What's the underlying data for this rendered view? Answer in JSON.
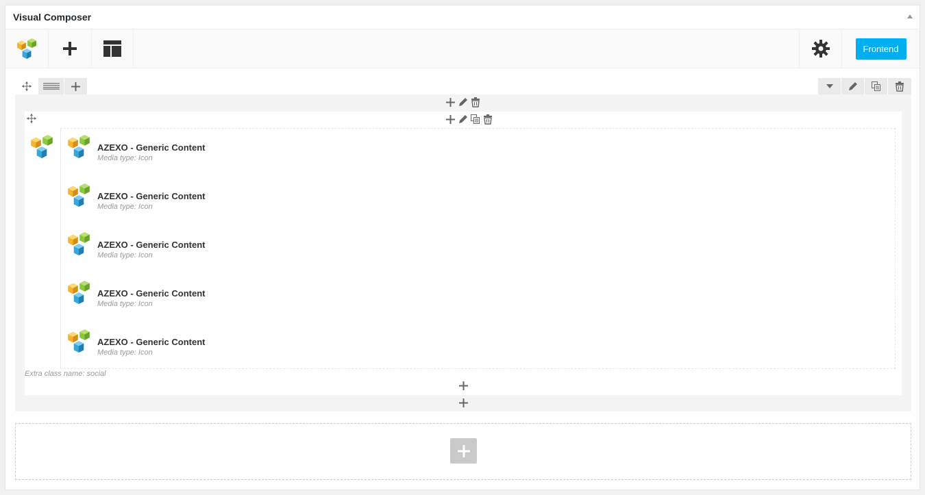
{
  "panel": {
    "title": "Visual Composer"
  },
  "navbar": {
    "logo_icon": "vc-logo-icon",
    "add_element_icon": "plus-icon",
    "templates_icon": "templates-icon",
    "settings_icon": "gear-icon",
    "frontend_label": "Frontend"
  },
  "row": {
    "controls_left": [
      "move-icon",
      "layout-icon",
      "plus-icon"
    ],
    "controls_right": [
      "chevron-down-icon",
      "pencil-icon",
      "copy-icon",
      "trash-icon"
    ],
    "column": {
      "extra_class": "Extra class name: social",
      "elements": [
        {
          "title": "AZEXO - Generic Content",
          "subtitle": "Media type: Icon"
        },
        {
          "title": "AZEXO - Generic Content",
          "subtitle": "Media type: Icon"
        },
        {
          "title": "AZEXO - Generic Content",
          "subtitle": "Media type: Icon"
        },
        {
          "title": "AZEXO - Generic Content",
          "subtitle": "Media type: Icon"
        },
        {
          "title": "AZEXO - Generic Content",
          "subtitle": "Media type: Icon"
        }
      ]
    }
  },
  "colors": {
    "accent": "#00aef0",
    "logo_orange": "#f7b230",
    "logo_green": "#8dc63f",
    "logo_blue": "#38a7d8"
  }
}
